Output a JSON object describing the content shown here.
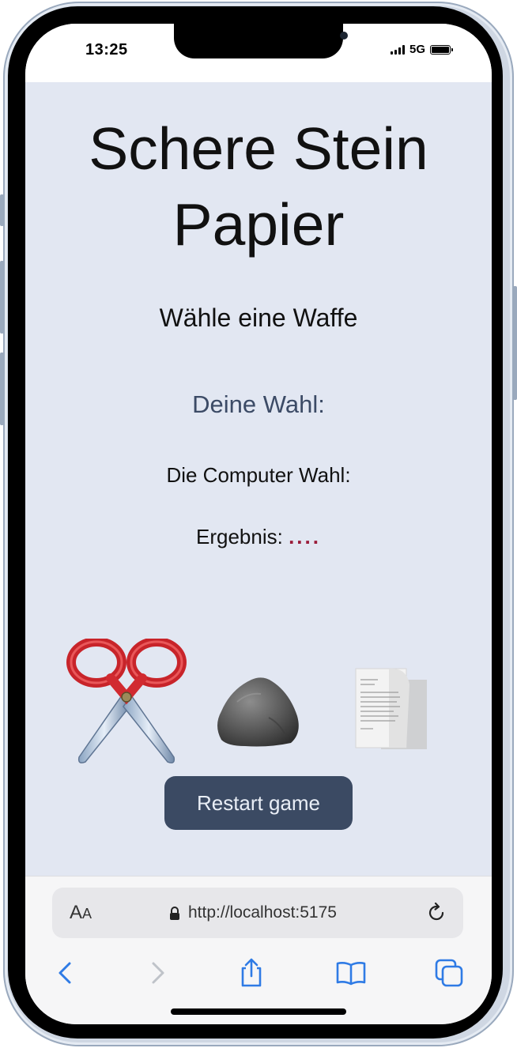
{
  "status_bar": {
    "time": "13:25",
    "network": "5G"
  },
  "game": {
    "title": "Schere Stein Papier",
    "prompt": "Wähle eine Waffe",
    "your_choice_label": "Deine Wahl:",
    "computer_choice_label": "Die Computer Wahl:",
    "result_label": "Ergebnis:",
    "result_value": "....",
    "weapons": [
      {
        "name": "Schere",
        "icon": "scissors-icon"
      },
      {
        "name": "Stein",
        "icon": "rock-icon"
      },
      {
        "name": "Papier",
        "icon": "paper-icon"
      }
    ],
    "restart_label": "Restart game"
  },
  "browser": {
    "text_size_label_big": "A",
    "text_size_label_small": "A",
    "url": "http://localhost:5175",
    "nav_icons": [
      "back-icon",
      "forward-icon",
      "share-icon",
      "bookmarks-icon",
      "tabs-icon"
    ]
  },
  "colors": {
    "page_background": "#e2e7f2",
    "button_background": "#3b4a63",
    "button_text": "#e9eef6",
    "your_choice_text": "#3c4b66",
    "result_value_text": "#9a1c3a",
    "safari_accent": "#2f7be5"
  }
}
